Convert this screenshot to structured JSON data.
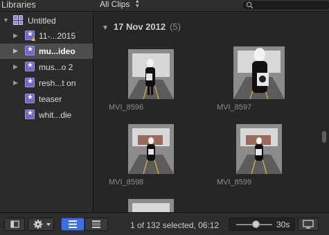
{
  "header": {
    "libraries_title": "Libraries",
    "filter_label": "All Clips"
  },
  "sidebar": {
    "library": "Untitled",
    "events": [
      {
        "label": "11-...2015",
        "warning": true
      },
      {
        "label": "mu...ideo",
        "selected": true
      },
      {
        "label": "mus...o 2"
      },
      {
        "label": "resh...t on"
      },
      {
        "label": "teaser"
      },
      {
        "label": "whit...die"
      }
    ]
  },
  "browser": {
    "group": {
      "date": "17 Nov 2012",
      "count": "(5)"
    },
    "clips": [
      {
        "name": "MVI_8596"
      },
      {
        "name": "MVI_8597"
      },
      {
        "name": "MVI_8598"
      },
      {
        "name": "MVI_8599"
      }
    ]
  },
  "footer": {
    "status": "1 of 132 selected, 06:12",
    "zoom_value": "30s",
    "zoom_level": 0.55
  }
}
